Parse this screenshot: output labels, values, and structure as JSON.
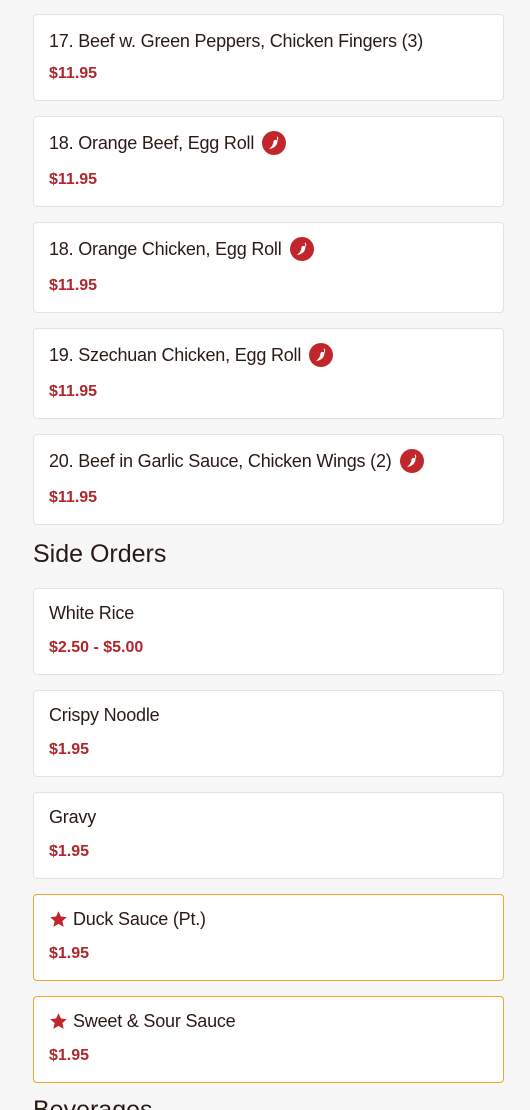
{
  "colors": {
    "price": "#b0262b",
    "accent_border": "#e6a92b",
    "title": "#2a1a16",
    "spicy_icon": "#c0262c"
  },
  "combos": [
    {
      "name": "17. Beef w. Green Peppers, Chicken Fingers (3)",
      "price": "$11.95",
      "spicy": false
    },
    {
      "name": "18. Orange Beef, Egg Roll",
      "price": "$11.95",
      "spicy": true
    },
    {
      "name": "18. Orange Chicken, Egg Roll",
      "price": "$11.95",
      "spicy": true
    },
    {
      "name": "19. Szechuan Chicken, Egg Roll",
      "price": "$11.95",
      "spicy": true
    },
    {
      "name": "20. Beef in Garlic Sauce, Chicken Wings (2)",
      "price": "$11.95",
      "spicy": true
    }
  ],
  "side_orders": {
    "title": "Side Orders",
    "items": [
      {
        "name": "White Rice",
        "price": "$2.50 - $5.00",
        "featured": false
      },
      {
        "name": "Crispy Noodle",
        "price": "$1.95",
        "featured": false
      },
      {
        "name": "Gravy",
        "price": "$1.95",
        "featured": false
      },
      {
        "name": "Duck Sauce (Pt.)",
        "price": "$1.95",
        "featured": true
      },
      {
        "name": "Sweet & Sour Sauce",
        "price": "$1.95",
        "featured": true
      }
    ]
  },
  "next_section": {
    "title": "Beverages"
  }
}
